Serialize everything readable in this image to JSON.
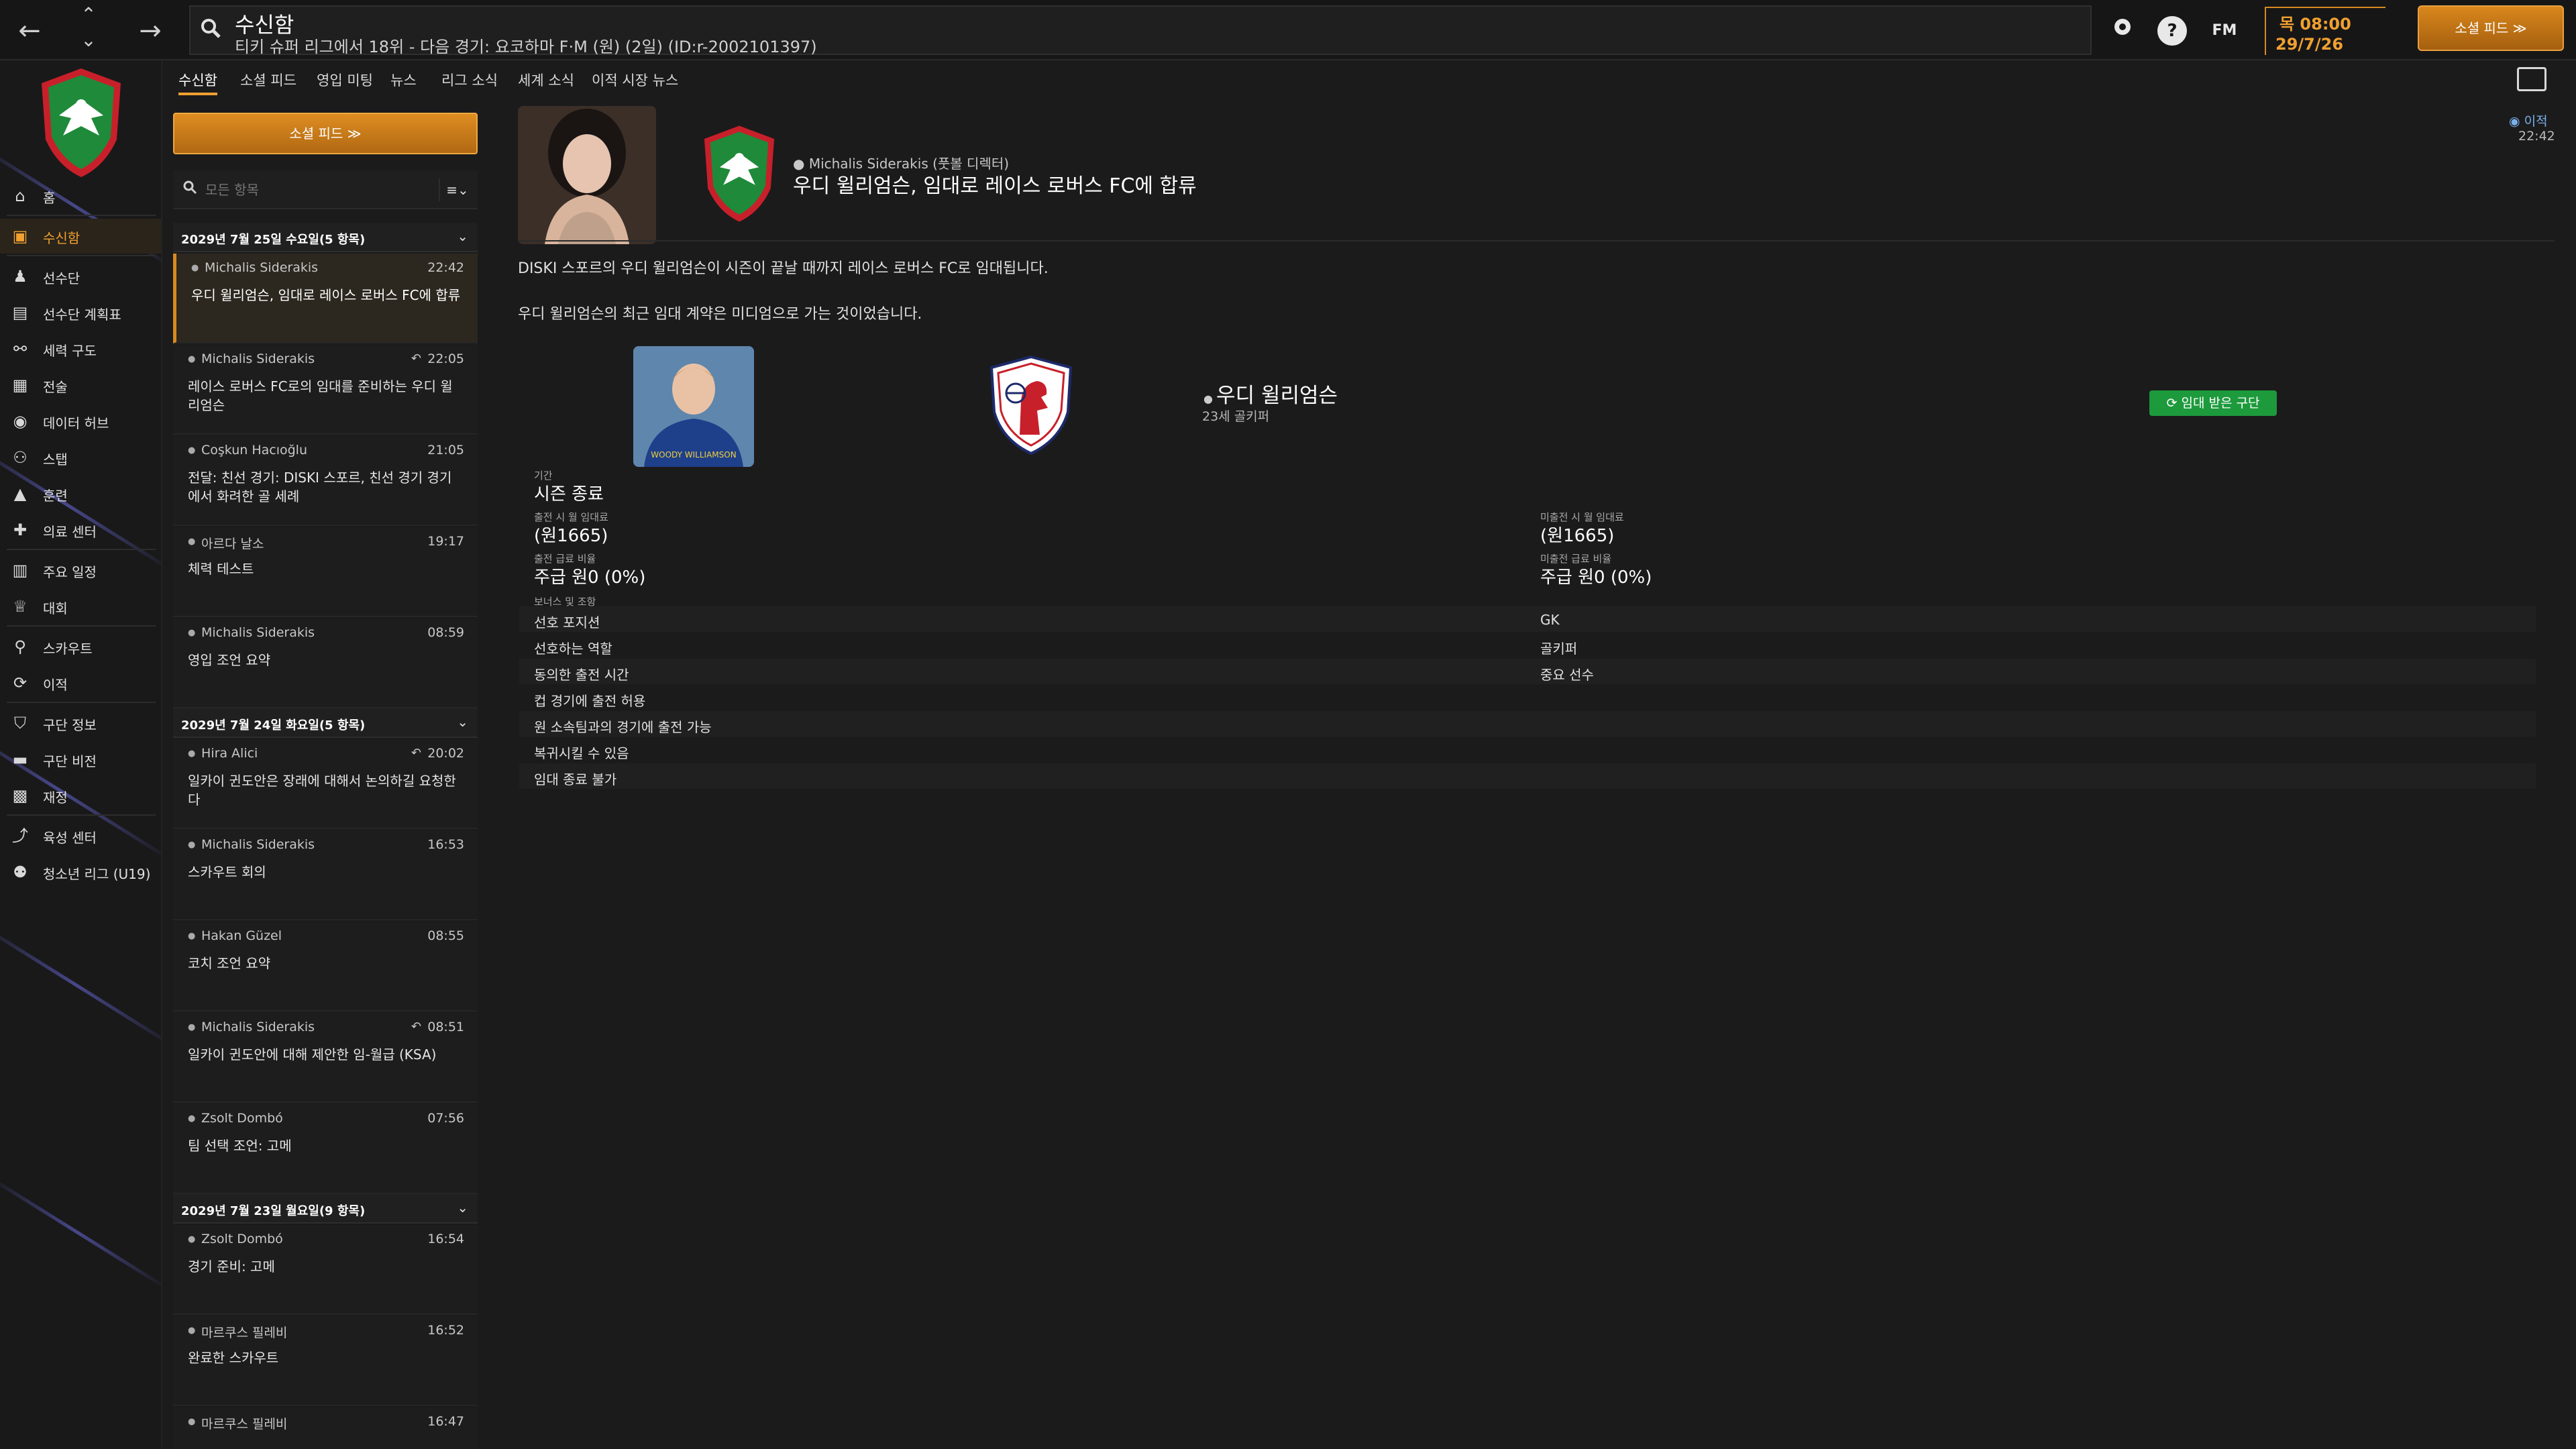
{
  "topbar": {
    "title": "수신함",
    "subtitle": "티키 슈퍼 리그에서 18위 - 다음 경기: 요코하마 F·M (원) (2일) (ID:r-2002101397)",
    "fm_label": "FM",
    "time": "목 08:00",
    "date": "29/7/26",
    "social_button": "소셜 피드 ≫"
  },
  "sidebar": {
    "items": [
      {
        "label": "홈",
        "icon": "home-icon"
      },
      {
        "label": "수신함",
        "icon": "inbox-icon"
      },
      {
        "label": "선수단",
        "icon": "squad-icon"
      },
      {
        "label": "선수단 계획표",
        "icon": "planner-icon"
      },
      {
        "label": "세력 구도",
        "icon": "dynamics-icon"
      },
      {
        "label": "전술",
        "icon": "tactics-icon"
      },
      {
        "label": "데이터 허브",
        "icon": "data-hub-icon"
      },
      {
        "label": "스탭",
        "icon": "staff-icon"
      },
      {
        "label": "훈련",
        "icon": "training-icon"
      },
      {
        "label": "의료 센터",
        "icon": "medical-icon"
      },
      {
        "label": "주요 일정",
        "icon": "calendar-icon"
      },
      {
        "label": "대회",
        "icon": "trophy-icon"
      },
      {
        "label": "스카우트",
        "icon": "scouting-icon"
      },
      {
        "label": "이적",
        "icon": "transfers-icon"
      },
      {
        "label": "구단 정보",
        "icon": "club-info-icon"
      },
      {
        "label": "구단 비전",
        "icon": "club-vision-icon"
      },
      {
        "label": "재정",
        "icon": "finances-icon"
      },
      {
        "label": "육성 센터",
        "icon": "dev-centre-icon"
      },
      {
        "label": "청소년 리그 (U19)",
        "icon": "youth-icon"
      }
    ]
  },
  "tabs": [
    "수신함",
    "소셜 피드",
    "영입 미팅",
    "뉴스",
    "리그 소식",
    "세계 소식",
    "이적 시장 뉴스"
  ],
  "list": {
    "social_button": "소셜 피드 ≫",
    "filter_placeholder": "모든 항목",
    "filter_menu": "≡⌄",
    "groups": [
      {
        "header": "2029년 7월 25일 수요일(5 항목)",
        "messages": [
          {
            "sender": "Michalis Siderakis",
            "time": "22:42",
            "subject": "우디 윌리엄슨, 임대로 레이스 로버스 FC에 합류",
            "reply": ""
          },
          {
            "sender": "Michalis Siderakis",
            "time": "22:05",
            "subject": "레이스 로버스 FC로의 임대를 준비하는 우디 윌리엄슨",
            "reply": "↶"
          },
          {
            "sender": "Coşkun Hacıoğlu",
            "time": "21:05",
            "subject": "전달: 친선 경기: DISKI 스포르, 친선 경기 경기에서 화려한 골 세례",
            "reply": ""
          },
          {
            "sender": "아르다 날소",
            "time": "19:17",
            "subject": "체력 테스트",
            "reply": ""
          },
          {
            "sender": "Michalis Siderakis",
            "time": "08:59",
            "subject": "영입 조언 요약",
            "reply": ""
          }
        ]
      },
      {
        "header": "2029년 7월 24일 화요일(5 항목)",
        "messages": [
          {
            "sender": "Hira Alici",
            "time": "20:02",
            "subject": "일카이 귄도안은 장래에 대해서 논의하길 요청한다",
            "reply": "↶"
          },
          {
            "sender": "Michalis Siderakis",
            "time": "16:53",
            "subject": "스카우트 회의",
            "reply": ""
          },
          {
            "sender": "Hakan Güzel",
            "time": "08:55",
            "subject": "코치 조언 요약",
            "reply": ""
          },
          {
            "sender": "Michalis Siderakis",
            "time": "08:51",
            "subject": "일카이 귄도안에 대해 제안한 임-월급 (KSA)",
            "reply": "↶"
          },
          {
            "sender": "Zsolt Dombó",
            "time": "07:56",
            "subject": "팀 선택 조언: 고메",
            "reply": ""
          }
        ]
      },
      {
        "header": "2029년 7월 23일 월요일(9 항목)",
        "messages": [
          {
            "sender": "Zsolt Dombó",
            "time": "16:54",
            "subject": "경기 준비: 고메",
            "reply": ""
          },
          {
            "sender": "마르쿠스 필레비",
            "time": "16:52",
            "subject": "완료한 스카우트",
            "reply": ""
          },
          {
            "sender": "마르쿠스 필레비",
            "time": "16:47",
            "subject": "",
            "reply": ""
          }
        ]
      }
    ]
  },
  "detail": {
    "sender_line": "Michalis Siderakis (풋볼 디렉터)",
    "subject": "우디 윌리엄슨, 임대로 레이스 로버스 FC에 합류",
    "tag": "이적",
    "time": "22:42",
    "body1": "DISKI 스포르의 우디 윌리엄슨이 시즌이 끝날 때까지 레이스 로버스 FC로 임대됩니다.",
    "body2": "우디 윌리엄슨의 최근 임대 계약은 미디엄으로 가는 것이었습니다.",
    "player_name": "우디 윌리엄슨",
    "player_info": "23세 골키퍼",
    "loan_status": "임대 받은 구단",
    "jersey_text": "WOODY WILLIAMSON",
    "period_label": "기간",
    "period_value": "시즌 종료",
    "fee_play_label": "출전 시 월 임대료",
    "fee_play_value": "(원1665)",
    "fee_noplay_label": "미출전 시 월 임대료",
    "fee_noplay_value": "(원1665)",
    "wage_play_label": "출전 급료 비율",
    "wage_play_value": "주급 원0 (0%)",
    "wage_noplay_label": "미출전 급료 비율",
    "wage_noplay_value": "주급 원0 (0%)",
    "bonus_label": "보너스 및 조항",
    "terms": [
      {
        "left": "선호 포지션",
        "right": "GK"
      },
      {
        "left": "선호하는 역할",
        "right": "골키퍼"
      },
      {
        "left": "동의한 출전 시간",
        "right": "중요 선수"
      },
      {
        "left": "컵 경기에 출전 허용",
        "right": ""
      },
      {
        "left": "원 소속팀과의 경기에 출전 가능",
        "right": ""
      },
      {
        "left": "복귀시킬 수 있음",
        "right": ""
      },
      {
        "left": "임대 종료 불가",
        "right": ""
      }
    ]
  },
  "colors": {
    "accent": "#f0a030",
    "green": "#1d9a3c",
    "club_green": "#1f8a3a",
    "club_red": "#c8202a"
  }
}
